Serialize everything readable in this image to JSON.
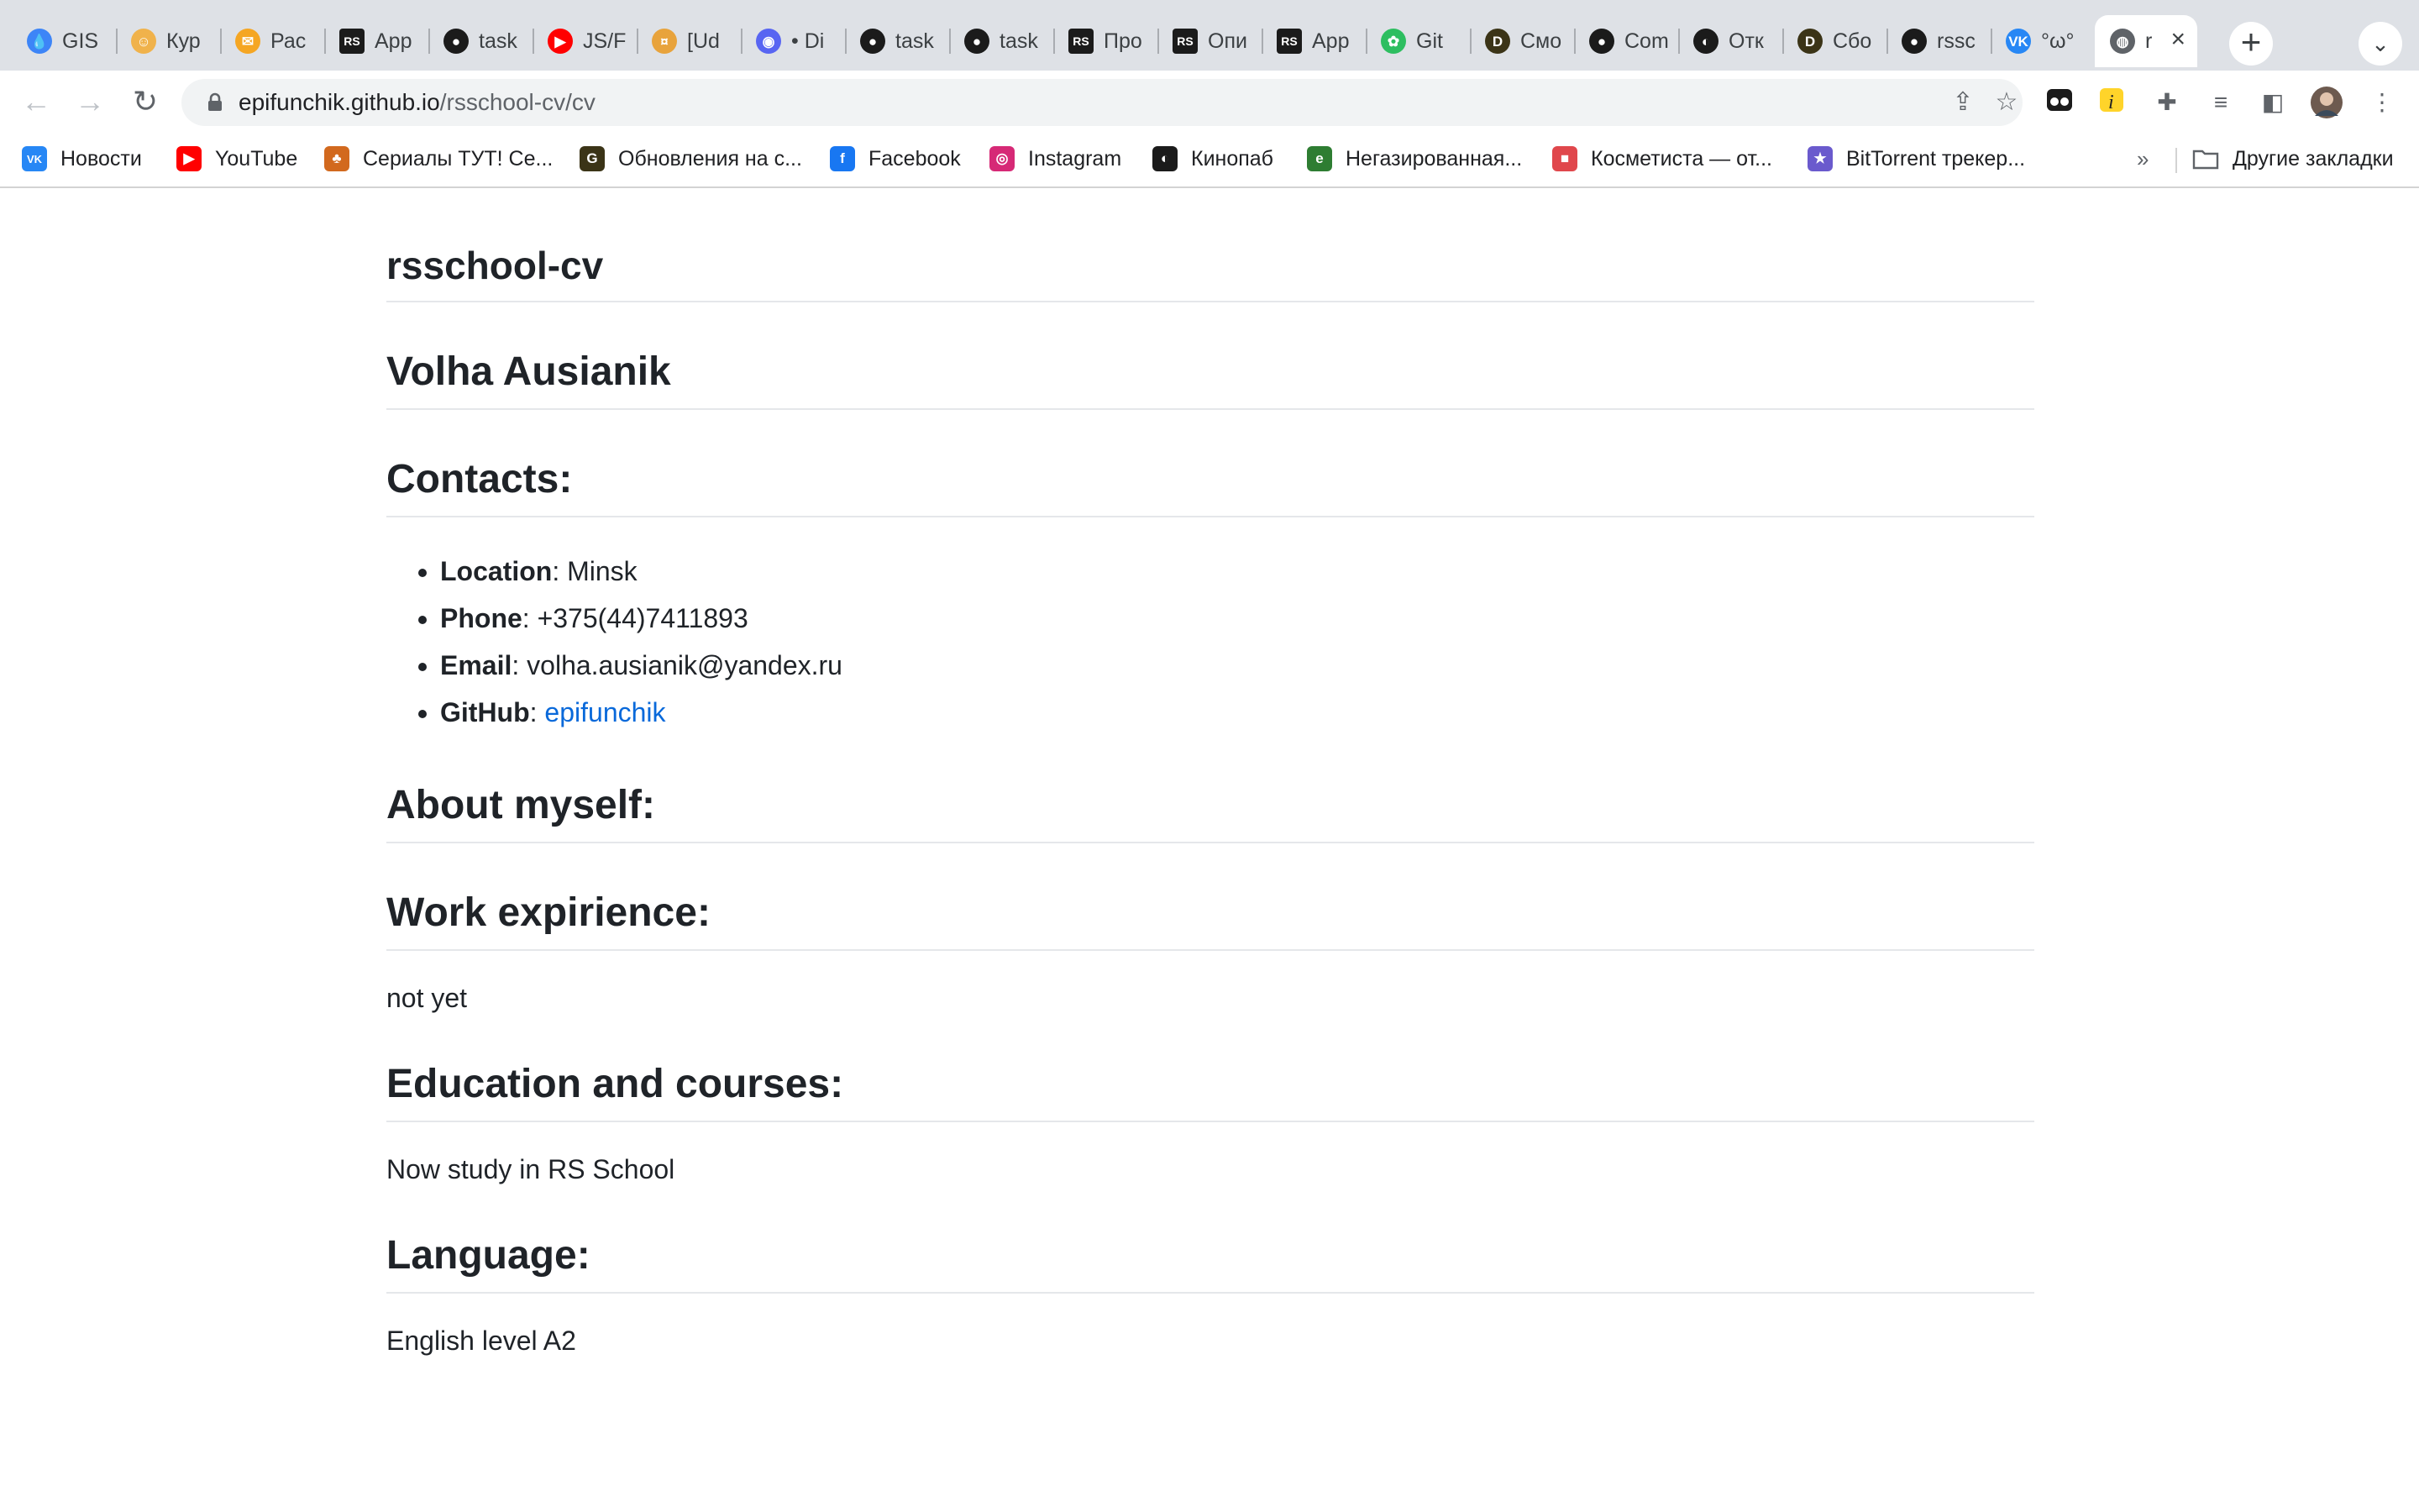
{
  "browser": {
    "tabs": [
      {
        "label": "GIS",
        "icon": "drop-icon",
        "color": "#3d85f7"
      },
      {
        "label": "Кур",
        "icon": "face-icon",
        "color": "#f0b24b"
      },
      {
        "label": "Рас",
        "icon": "mail-icon",
        "color": "#f5a623"
      },
      {
        "label": "App",
        "icon": "rs-icon",
        "color": "#1b1b1b"
      },
      {
        "label": "task",
        "icon": "github-icon",
        "color": "#1b1b1b"
      },
      {
        "label": "JS/F",
        "icon": "youtube-icon",
        "color": "#ff0000"
      },
      {
        "label": "[Ud",
        "icon": "coins-icon",
        "color": "#e8a33c"
      },
      {
        "label": "• Di",
        "icon": "discord-icon",
        "color": "#5865f2"
      },
      {
        "label": "task",
        "icon": "github-icon",
        "color": "#1b1b1b"
      },
      {
        "label": "task",
        "icon": "github-icon",
        "color": "#1b1b1b"
      },
      {
        "label": "Про",
        "icon": "rs-icon",
        "color": "#1b1b1b"
      },
      {
        "label": "Опи",
        "icon": "rs-icon",
        "color": "#1b1b1b"
      },
      {
        "label": "App",
        "icon": "rs-icon",
        "color": "#1b1b1b"
      },
      {
        "label": "Git",
        "icon": "evernote-icon",
        "color": "#2dbe60"
      },
      {
        "label": "Смо",
        "icon": "d-icon",
        "color": "#3b3417"
      },
      {
        "label": "Com",
        "icon": "github-icon",
        "color": "#1b1b1b"
      },
      {
        "label": "Отк",
        "icon": "kinopub-icon",
        "color": "#1b1b1b"
      },
      {
        "label": "Сбо",
        "icon": "d-icon",
        "color": "#3b3417"
      },
      {
        "label": "rssc",
        "icon": "github-icon",
        "color": "#1b1b1b"
      },
      {
        "label": "°ω°",
        "icon": "vk-icon",
        "color": "#2787f5"
      },
      {
        "label": "r",
        "icon": "globe-icon",
        "color": "#5f6368"
      }
    ],
    "url_host": "epifunchik.github.io",
    "url_path": "/rsschool-cv/cv",
    "bookmarks": [
      {
        "label": "Новости",
        "icon": "vk-icon",
        "color": "#2787f5"
      },
      {
        "label": "YouTube",
        "icon": "youtube-icon",
        "color": "#ff0000"
      },
      {
        "label": "Сериалы ТУТ! Се...",
        "icon": "cat-icon",
        "color": "#d2691e"
      },
      {
        "label": "Обновления на с...",
        "icon": "g-icon",
        "color": "#3b3417"
      },
      {
        "label": "Facebook",
        "icon": "facebook-icon",
        "color": "#1877f2"
      },
      {
        "label": "Instagram",
        "icon": "instagram-icon",
        "color": "#d62976"
      },
      {
        "label": "Кинопаб",
        "icon": "kinopub-icon",
        "color": "#1b1b1b"
      },
      {
        "label": "Негазированная...",
        "icon": "e-icon",
        "color": "#2e7d32"
      },
      {
        "label": "Косметиста — от...",
        "icon": "cosmetista-icon",
        "color": "#e0474c"
      },
      {
        "label": "BitTorrent трекер...",
        "icon": "star-icon",
        "color": "#6a5acd"
      }
    ],
    "bookmarks_more": "»",
    "other_bookmarks": "Другие закладки"
  },
  "page": {
    "repo_title": "rsschool-cv",
    "name": "Volha Ausianik",
    "contacts_heading": "Contacts:",
    "contacts": [
      {
        "key": "Location",
        "sep": ": ",
        "value": "Minsk"
      },
      {
        "key": "Phone",
        "sep": ": ",
        "value": "+375(44)7411893"
      },
      {
        "key": "Email",
        "sep": ": ",
        "value": "volha.ausianik@yandex.ru"
      },
      {
        "key": "GitHub",
        "sep": ": ",
        "value": "epifunchik"
      }
    ],
    "about_heading": "About myself:",
    "work_heading": "Work expirience:",
    "work_text": "not yet",
    "education_heading": "Education and courses:",
    "education_text": "Now study in RS School",
    "language_heading": "Language:",
    "language_text": "English level A2",
    "link_color": "#0969da"
  }
}
